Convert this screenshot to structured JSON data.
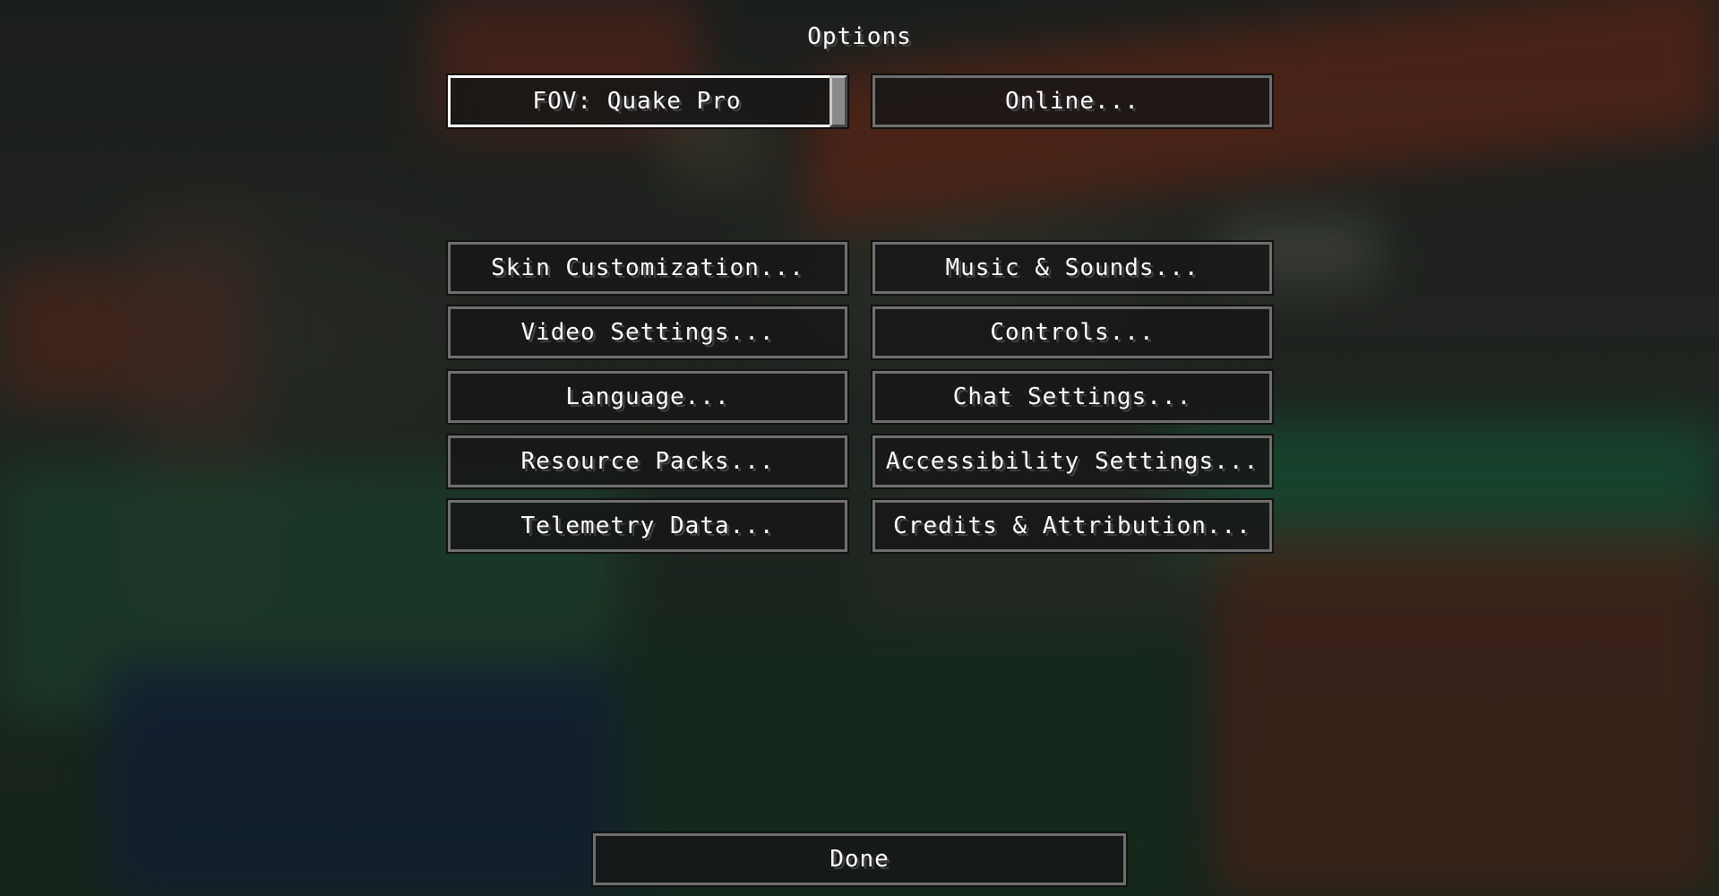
{
  "screen": {
    "title": "Options"
  },
  "top_row": {
    "fov_slider": {
      "label": "FOV: Quake Pro",
      "value_text": "Quake Pro"
    },
    "online_button": "Online..."
  },
  "buttons": {
    "skin_customization": "Skin Customization...",
    "music_sounds": "Music & Sounds...",
    "video_settings": "Video Settings...",
    "controls": "Controls...",
    "language": "Language...",
    "chat_settings": "Chat Settings...",
    "resource_packs": "Resource Packs...",
    "accessibility_settings": "Accessibility Settings...",
    "telemetry_data": "Telemetry Data...",
    "credits_attribution": "Credits & Attribution..."
  },
  "footer": {
    "done_label": "Done"
  },
  "colors": {
    "text": "#ffffff",
    "button_border": "#6f6f6f",
    "selected_border": "#ffffff",
    "button_fill": "#161616"
  }
}
